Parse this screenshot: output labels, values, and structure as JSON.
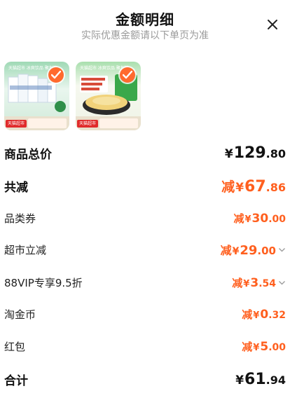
{
  "header": {
    "title": "金额明细",
    "subtitle": "实际优惠金额请以下单页为准"
  },
  "products": [
    {
      "top_text": "天猫超市 冰爽饮品 聚划算",
      "tag": "天猫超市"
    },
    {
      "top_text": "天猫超市 冰爽饮品 聚划算",
      "tag": "天猫超市"
    }
  ],
  "rows": {
    "total_price": {
      "label": "商品总价",
      "yen": "¥",
      "int": "129",
      "dec": ".80"
    },
    "total_discount": {
      "label": "共减",
      "prefix": "减",
      "yen": "¥",
      "int": "67",
      "dec": ".86"
    },
    "category_coupon": {
      "label": "品类券",
      "prefix": "减",
      "yen": "¥",
      "int": "30",
      "dec": ".00"
    },
    "market_discount": {
      "label": "超市立减",
      "prefix": "减",
      "yen": "¥",
      "int": "29",
      "dec": ".00"
    },
    "vip_discount": {
      "label": "88VIP专享9.5折",
      "prefix": "减",
      "yen": "¥",
      "int": "3",
      "dec": ".54"
    },
    "taojin_coin": {
      "label": "淘金币",
      "prefix": "减",
      "yen": "¥",
      "int": "0",
      "dec": ".32"
    },
    "red_packet": {
      "label": "红包",
      "prefix": "减",
      "yen": "¥",
      "int": "5",
      "dec": ".00"
    },
    "grand_total": {
      "label": "合计",
      "yen": "¥",
      "int": "61",
      "dec": ".94"
    }
  },
  "colors": {
    "accent": "#ff5f1e",
    "check": "#ff6a2e"
  },
  "icons": {
    "close": "close-icon",
    "check": "checkmark-icon",
    "expand": "chevron-down-icon"
  }
}
